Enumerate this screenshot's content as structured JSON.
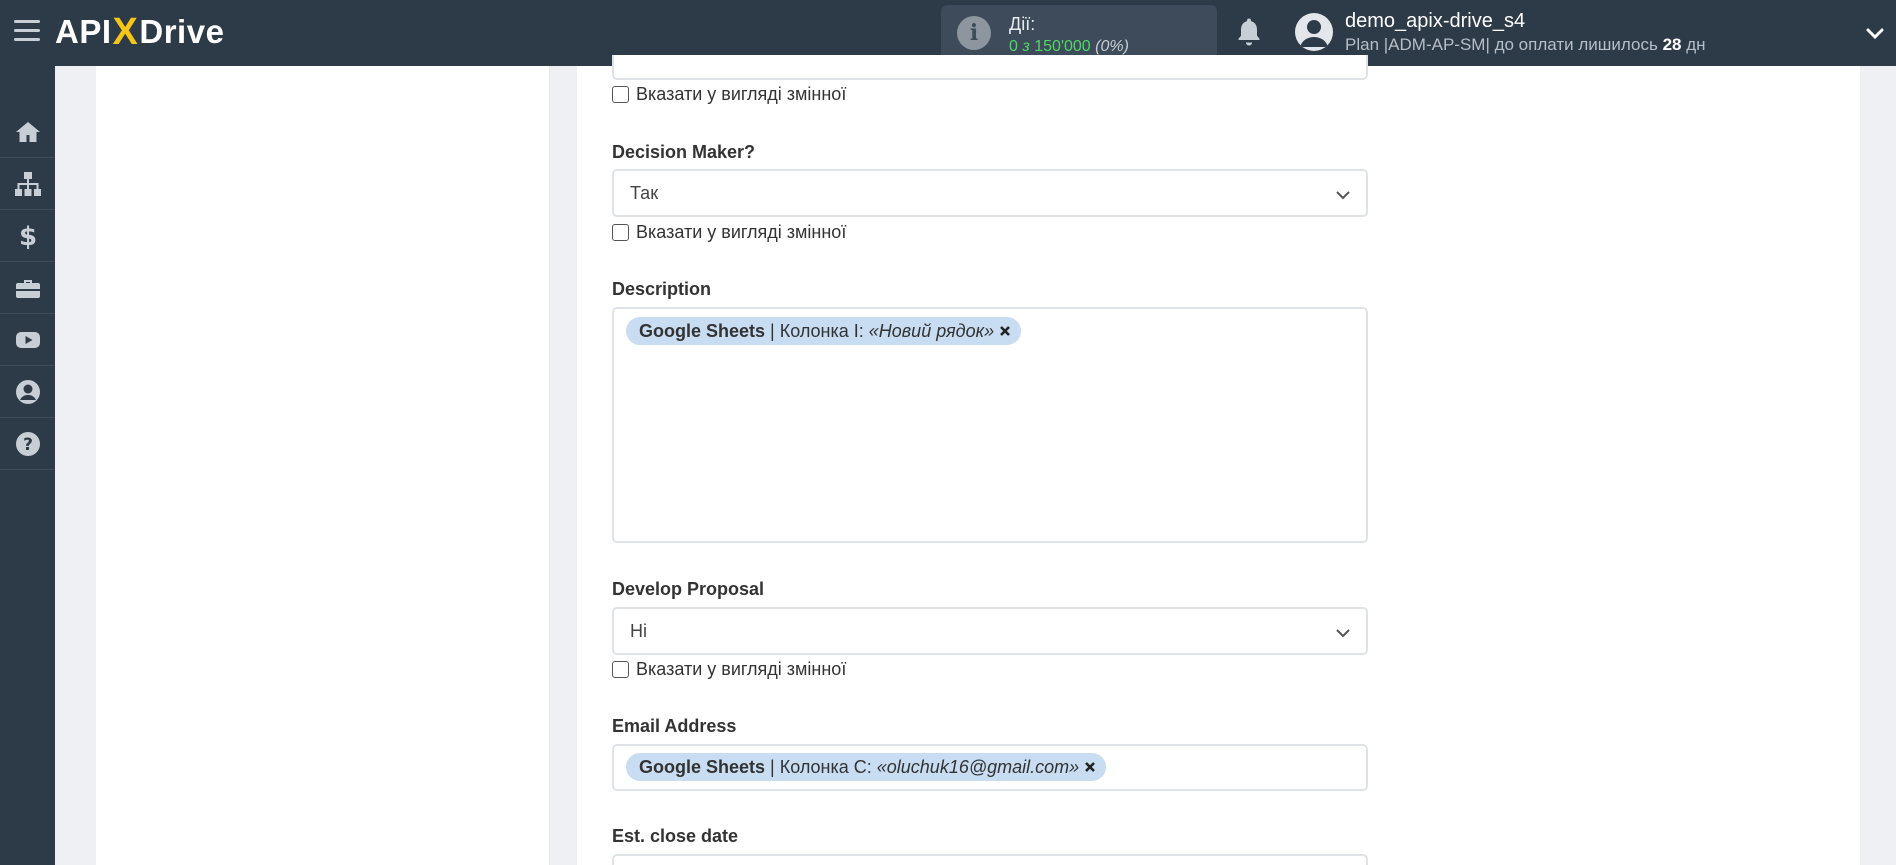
{
  "header": {
    "logo_left": "API",
    "logo_x": "X",
    "logo_right": "Drive",
    "actions_title": "Дії:",
    "actions_used": "0",
    "actions_of": "з",
    "actions_total": "150'000",
    "actions_percent": "(0%)",
    "user_name": "demo_apix-drive_s4",
    "plan_text": "Plan |ADM-AP-SM| до оплати лишилось",
    "plan_days": "28",
    "plan_days_unit": "дн"
  },
  "sidebar": {
    "items": [
      "home-icon",
      "sitemap-icon",
      "dollar-icon",
      "briefcase-icon",
      "youtube-icon",
      "user-circle-icon",
      "question-icon"
    ]
  },
  "form": {
    "checkbox_label": "Вказати у вигляді змінної",
    "decision_maker": {
      "label": "Decision Maker?",
      "value": "Так"
    },
    "description": {
      "label": "Description",
      "tag": {
        "source": "Google Sheets",
        "separator": "|",
        "column": "Колонка I:",
        "value": "«Новий рядок»"
      }
    },
    "develop_proposal": {
      "label": "Develop Proposal",
      "value": "Ні"
    },
    "email_address": {
      "label": "Email Address",
      "tag": {
        "source": "Google Sheets",
        "separator": "|",
        "column": "Колонка C:",
        "value": "«oluchuk16@gmail.com»"
      }
    },
    "est_close_date": {
      "label": "Est. close date"
    }
  },
  "colors": {
    "topbar": "#2d3a48",
    "accent_logo": "#f5c518",
    "used_green": "#4cd964",
    "tag_bg": "#c8dcf2"
  }
}
